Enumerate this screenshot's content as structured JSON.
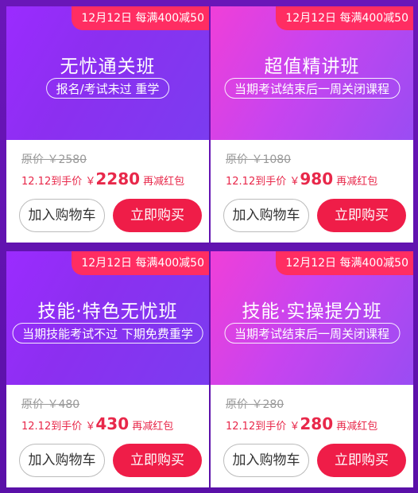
{
  "cards": [
    {
      "promo": "12月12日 每满400减50",
      "title": "无忧通关班",
      "subtitle": "报名/考试未过 重学",
      "original_price": "原价 ￥2580",
      "sale_prefix": "12.12到手价 ￥",
      "sale_price": "2280",
      "sale_suffix": " 再减红包",
      "cart_label": "加入购物车",
      "buy_label": "立即购买"
    },
    {
      "promo": "12月12日 每满400减50",
      "title": "超值精讲班",
      "subtitle": "当期考试结束后一周关闭课程",
      "original_price": "原价 ￥1080",
      "sale_prefix": "12.12到手价 ￥",
      "sale_price": "980",
      "sale_suffix": " 再减红包",
      "cart_label": "加入购物车",
      "buy_label": "立即购买"
    },
    {
      "promo": "12月12日 每满400减50",
      "title": "技能·特色无忧班",
      "subtitle": "当期技能考试不过 下期免费重学",
      "original_price": "原价 ￥480",
      "sale_prefix": "12.12到手价 ￥",
      "sale_price": "430",
      "sale_suffix": " 再减红包",
      "cart_label": "加入购物车",
      "buy_label": "立即购买"
    },
    {
      "promo": "12月12日 每满400减50",
      "title": "技能·实操提分班",
      "subtitle": "当期考试结束后一周关闭课程",
      "original_price": "原价 ￥280",
      "sale_prefix": "12.12到手价 ￥",
      "sale_price": "280",
      "sale_suffix": " 再减红包",
      "cart_label": "加入购物车",
      "buy_label": "立即购买"
    }
  ],
  "colors": {
    "page_bg": "#6a16b8",
    "promo_badge": "#ff2d62",
    "sale_text": "#e8284a",
    "buy_button": "#ef1d48"
  }
}
